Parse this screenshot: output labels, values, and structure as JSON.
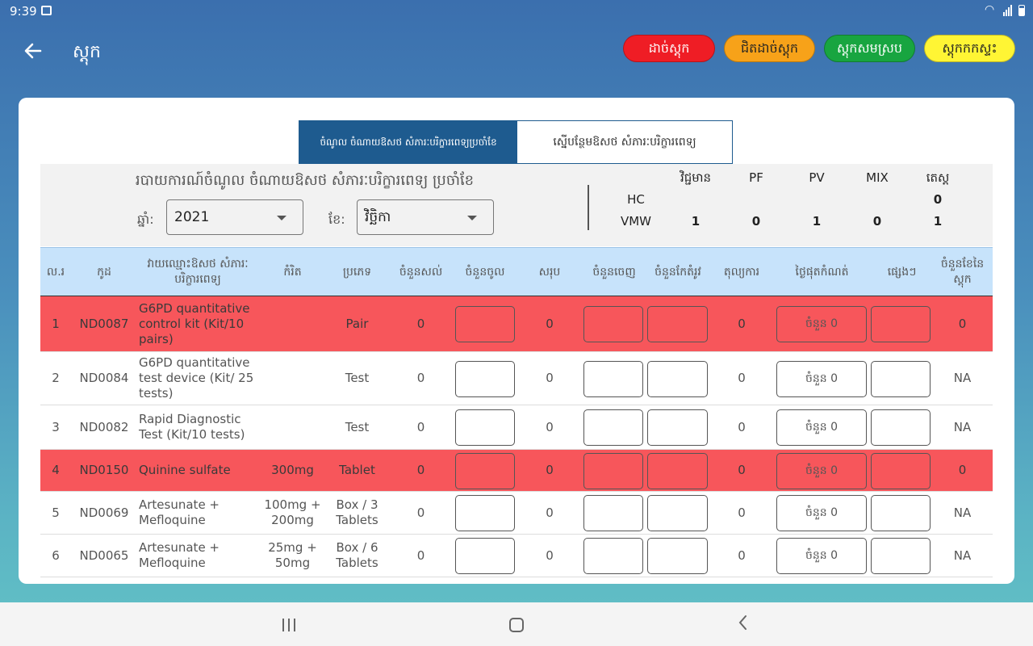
{
  "status": {
    "time": "9:39"
  },
  "appbar": {
    "title": "ស្តុក"
  },
  "legend": [
    {
      "label": "ដាច់ស្តុក",
      "color": "#ef1d25"
    },
    {
      "label": "ជិតដាច់ស្តុក",
      "color": "#f7a219"
    },
    {
      "label": "ស្តុកសមស្រប",
      "color": "#18a540"
    },
    {
      "label": "ស្តុកកកស្ទះ",
      "color": "#fff534"
    }
  ],
  "tabs": [
    {
      "label": "ចំណូល ចំណាយឱសថ សំភារៈបរិក្ខារពេទ្យប្រចាំខែ",
      "active": true
    },
    {
      "label": "ស្នើបន្ថែមឱសថ សំភារៈបរិក្ខារពេទ្យ",
      "active": false
    }
  ],
  "report": {
    "title": "របាយការណ៍ចំណូល ចំណាយឱសថ សំភារៈបរិក្ខារពេទ្យ ប្រចាំខែ",
    "year_label": "ឆ្នាំ:",
    "year_value": "2021",
    "month_label": "ខែ:",
    "month_value": "វិច្ឆិកា"
  },
  "stats": {
    "headers": [
      "វិជ្ជមាន",
      "PF",
      "PV",
      "MIX",
      "តេស្ត"
    ],
    "rows": [
      {
        "label": "HC",
        "values": [
          "",
          "",
          "",
          "",
          "0"
        ]
      },
      {
        "label": "VMW",
        "values": [
          "1",
          "0",
          "1",
          "0",
          "1"
        ]
      }
    ]
  },
  "table": {
    "columns": [
      "ល.រ",
      "កូដ",
      "វាយឈ្មោះឱសថ សំភារៈ បរិក្ខារពេទ្យ",
      "កំរិត",
      "ប្រភេទ",
      "ចំនួនសល់",
      "ចំនួនចូល",
      "សរុប",
      "ចំនួនចេញ",
      "ចំនួនកែតំរូវ",
      "តុល្យការ",
      "ថ្ងៃផុតកំណត់",
      "ផ្សេងៗ",
      "ចំនួនខែនៃ ស្តុក"
    ],
    "expiry_placeholder": "ចំនួន 0",
    "rows": [
      {
        "no": "1",
        "code": "ND0087",
        "name": "G6PD quantitative control kit (Kit/10 pairs)",
        "dose": "",
        "type": "Pair",
        "remain": "0",
        "total": "0",
        "balance": "0",
        "months": "0",
        "status": "red"
      },
      {
        "no": "2",
        "code": "ND0084",
        "name": "G6PD quantitative test device (Kit/ 25 tests)",
        "dose": "",
        "type": "Test",
        "remain": "0",
        "total": "0",
        "balance": "0",
        "months": "NA",
        "status": "normal"
      },
      {
        "no": "3",
        "code": "ND0082",
        "name": "Rapid Diagnostic Test (Kit/10 tests)",
        "dose": "",
        "type": "Test",
        "remain": "0",
        "total": "0",
        "balance": "0",
        "months": "NA",
        "status": "normal"
      },
      {
        "no": "4",
        "code": "ND0150",
        "name": "Quinine sulfate",
        "dose": "300mg",
        "type": "Tablet",
        "remain": "0",
        "total": "0",
        "balance": "0",
        "months": "0",
        "status": "red"
      },
      {
        "no": "5",
        "code": "ND0069",
        "name": "Artesunate + Mefloquine",
        "dose": "100mg + 200mg",
        "type": "Box / 3 Tablets",
        "remain": "0",
        "total": "0",
        "balance": "0",
        "months": "NA",
        "status": "normal"
      },
      {
        "no": "6",
        "code": "ND0065",
        "name": "Artesunate + Mefloquine",
        "dose": "25mg + 50mg",
        "type": "Box / 6 Tablets",
        "remain": "0",
        "total": "0",
        "balance": "0",
        "months": "NA",
        "status": "normal"
      }
    ]
  }
}
